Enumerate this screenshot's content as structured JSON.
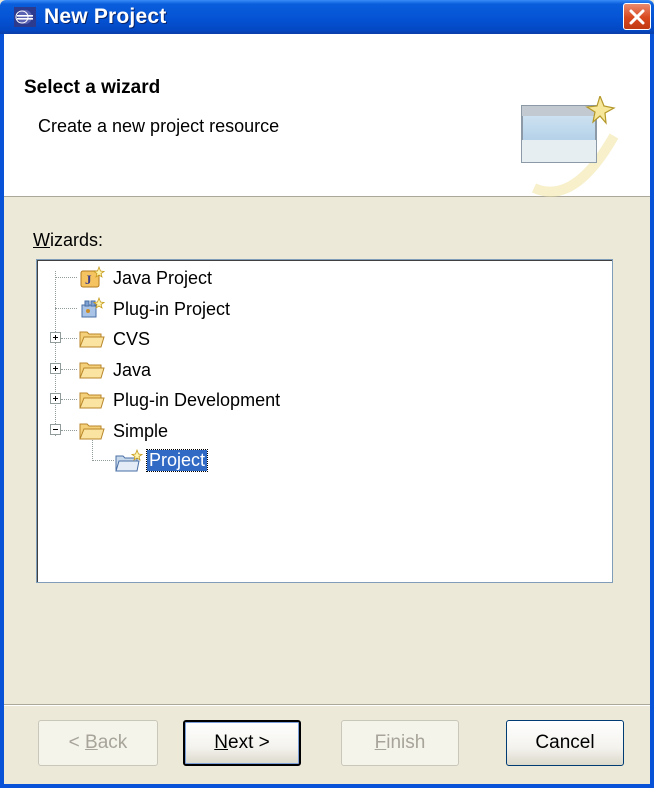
{
  "window": {
    "title": "New Project"
  },
  "header": {
    "title": "Select a wizard",
    "description": "Create a new project resource"
  },
  "wizards_label": {
    "prefix": "W",
    "rest": "izards:"
  },
  "tree": {
    "items": [
      {
        "label": "Java Project",
        "icon": "java-project-icon"
      },
      {
        "label": "Plug-in Project",
        "icon": "plugin-project-icon"
      },
      {
        "label": "CVS",
        "icon": "folder-icon",
        "expander": "plus"
      },
      {
        "label": "Java",
        "icon": "folder-icon",
        "expander": "plus"
      },
      {
        "label": "Plug-in Development",
        "icon": "folder-icon",
        "expander": "plus"
      },
      {
        "label": "Simple",
        "icon": "folder-open-icon",
        "expander": "minus"
      },
      {
        "label": "Project",
        "icon": "new-project-icon",
        "selected": true
      }
    ]
  },
  "buttons": {
    "back": {
      "pre": "< ",
      "key": "B",
      "post": "ack",
      "enabled": false
    },
    "next": {
      "pre": "",
      "key": "N",
      "post": "ext >",
      "enabled": true
    },
    "finish": {
      "pre": "",
      "key": "F",
      "post": "inish",
      "enabled": false
    },
    "cancel": {
      "label": "Cancel",
      "enabled": true
    }
  },
  "colors": {
    "titlebar": "#0555d6",
    "selection": "#316ac5",
    "dialog_bg": "#ece9d8"
  }
}
